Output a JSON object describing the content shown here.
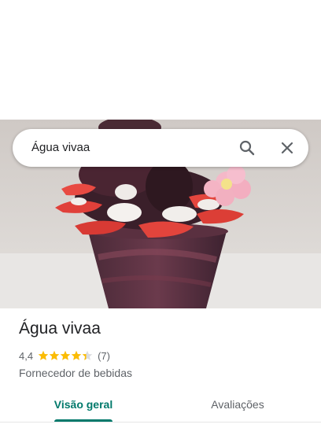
{
  "search": {
    "query": "Água vivaa",
    "search_icon": "search-icon",
    "close_icon": "close-icon"
  },
  "photo": {
    "description_icon": "place-photo"
  },
  "place": {
    "title": "Água vivaa",
    "rating_value": "4,4",
    "rating": 4.4,
    "rating_max": 5,
    "review_count": "(7)",
    "category": "Fornecedor de bebidas"
  },
  "tabs": [
    {
      "label": "Visão geral",
      "selected": true
    },
    {
      "label": "Avaliações",
      "selected": false
    }
  ],
  "colors": {
    "accent": "#00796b",
    "star": "#fbbc04",
    "star_empty": "#dadce0",
    "text_primary": "#202124",
    "text_secondary": "#5f6368"
  }
}
